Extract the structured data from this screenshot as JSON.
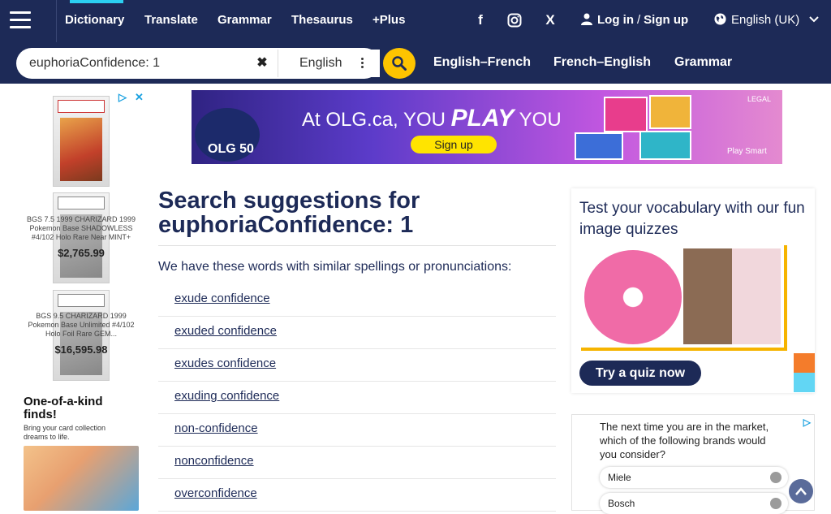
{
  "nav": {
    "menu_icon": "hamburger-icon",
    "links": [
      "Dictionary",
      "Translate",
      "Grammar",
      "Thesaurus",
      "+Plus"
    ],
    "social": [
      "f",
      "instagram",
      "X"
    ],
    "user_icon": "user-icon",
    "login": "Log in",
    "divider": "/",
    "signup": "Sign up",
    "language": "English (UK)",
    "globe_icon": "globe-icon"
  },
  "search": {
    "value": "euphoriaConfidence: 1",
    "clear_icon": "✖",
    "dictionary": "English",
    "tabs": [
      "English–French",
      "French–English",
      "Grammar"
    ]
  },
  "left_ad": {
    "captions": [
      "BGS 7.5 1999 CHARIZARD 1999 Pokemon Base SHADOWLESS #4/102 Holo Rare Near MINT+",
      "BGS 9.5 CHARIZARD 1999 Pokemon Base Unlimited #4/102 Holo Foil Rare GEM..."
    ],
    "prices": [
      "$2,765.99",
      "$16,595.98"
    ],
    "headline": "One-of-a-kind finds!",
    "subtext": "Bring your card collection dreams to life."
  },
  "banner": {
    "text_pre": "At OLG.ca, YOU ",
    "text_bold": "PLAY",
    "text_post": " YOU",
    "cta": "Sign up",
    "logo": "OLG 50",
    "legal": "LEGAL",
    "tagline": "Play Smart"
  },
  "results": {
    "heading_prefix": "Search suggestions for",
    "heading_term": "euphoriaConfidence: 1",
    "note": "We have these words with similar spellings or pronunciations:",
    "suggestions": [
      "exude confidence",
      "exuded confidence",
      "exudes confidence",
      "exuding confidence",
      "non-confidence",
      "nonconfidence",
      "overconfidence"
    ]
  },
  "quiz": {
    "title": "Test your vocabulary with our fun image quizzes",
    "button": "Try a quiz now"
  },
  "poll": {
    "question": "The next time you are in the market, which of the following brands would you consider?",
    "options": [
      "Miele",
      "Bosch"
    ]
  },
  "colors": {
    "header_bg": "#1d2a57",
    "accent_cyan": "#2bd0f2",
    "search_button": "#fec400"
  }
}
